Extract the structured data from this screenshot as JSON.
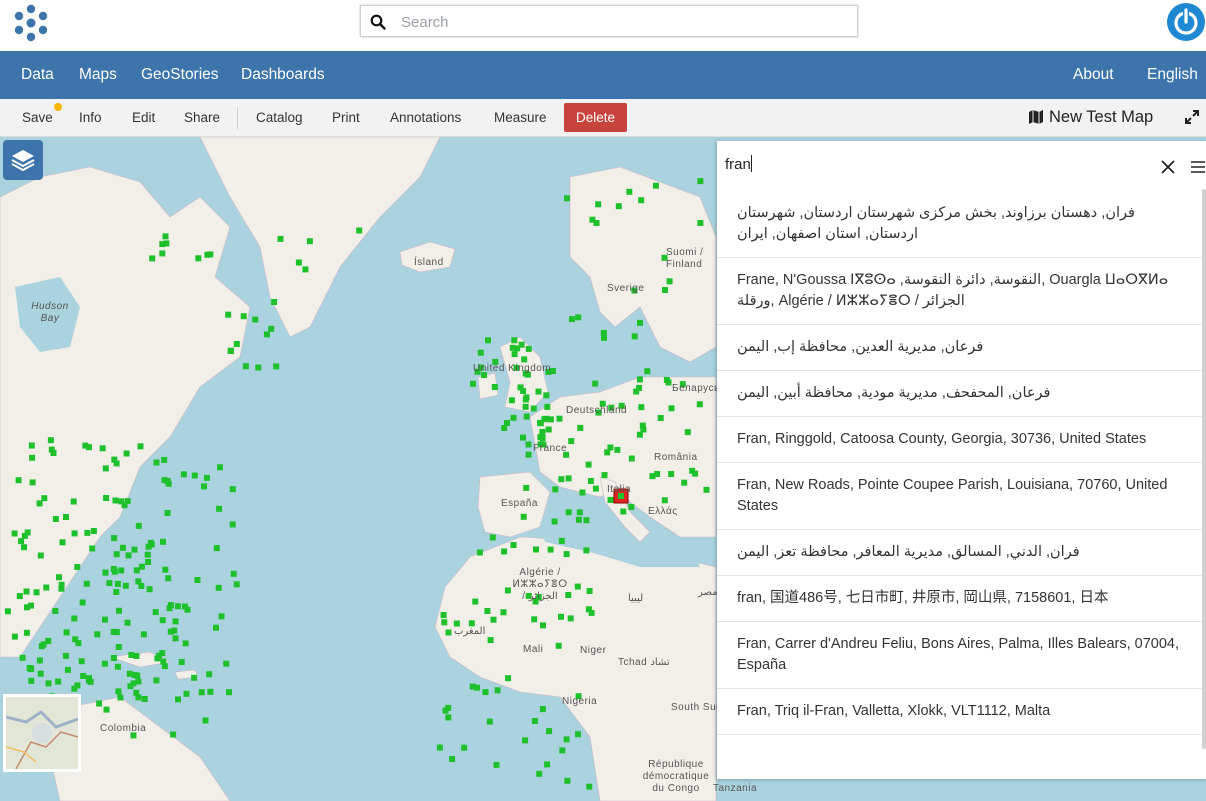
{
  "search": {
    "placeholder": "Search"
  },
  "nav": {
    "left": [
      "Data",
      "Maps",
      "GeoStories",
      "Dashboards"
    ],
    "right": [
      "About",
      "English"
    ]
  },
  "toolbar": {
    "items": [
      "Save",
      "Info",
      "Edit",
      "Share",
      "Catalog",
      "Print",
      "Annotations",
      "Measure"
    ],
    "delete_label": "Delete",
    "map_name": "New Test Map",
    "map_icon": "map-icon",
    "expand_icon": "expand-icon"
  },
  "map_labels": [
    "Ísland",
    "Hudson Bay",
    "United Kingdom",
    "Deutschland",
    "France",
    "España",
    "Italia",
    "Ελλάς",
    "România",
    "Беларусь",
    "Suomi / Finland",
    "Sverige",
    "Algérie / ⵍⵣⵣⴰⵢⴻⵔ / الجزائر",
    "المغرب",
    "ليبيا",
    "Mali",
    "Niger",
    "Tchad تشاد",
    "Nigeria",
    "Colombia",
    "République démocratique du Congo",
    "Tanzania",
    "South Sudan",
    "مصر"
  ],
  "results_panel": {
    "query": "fran",
    "items": [
      "فران, دهستان برزاوند, بخش مرکزی شهرستان اردستان, شهرستان اردستان, استان اصفهان, ایران",
      "Frane, N'Goussa ⵏⴳⵓⵙⴰ ,النقوسة, دائرة النقوسة, Ouargla ⵡⴰⵔⴳⵍⴰ ورقلة, Algérie / ⵍⵣⵣⴰⵢⴻⵔ / الجزائر",
      "فرعان, مديرية العدين, محافظة إب, اليمن",
      "فرعان, المحفحف, مديرية مودية, محافظة أبين, اليمن",
      "Fran, Ringgold, Catoosa County, Georgia, 30736, United States",
      "Fran, New Roads, Pointe Coupee Parish, Louisiana, 70760, United States",
      "فران, الدني, المسالق, مديرية المعافر, محافظة تعز, اليمن",
      "fran, 国道486号, 七日市町, 井原市, 岡山県, 7158601, 日本",
      "Fran, Carrer d'Andreu Feliu, Bons Aires, Palma, Illes Balears, 07004, España",
      "Fran, Triq il-Fran, Valletta, Xlokk, VLT1112, Malta"
    ]
  },
  "colors": {
    "nav": "#3c74ab",
    "delete": "#c7433b",
    "marker": "#1ec12c",
    "water": "#aad3df",
    "land": "#f2efe9"
  }
}
